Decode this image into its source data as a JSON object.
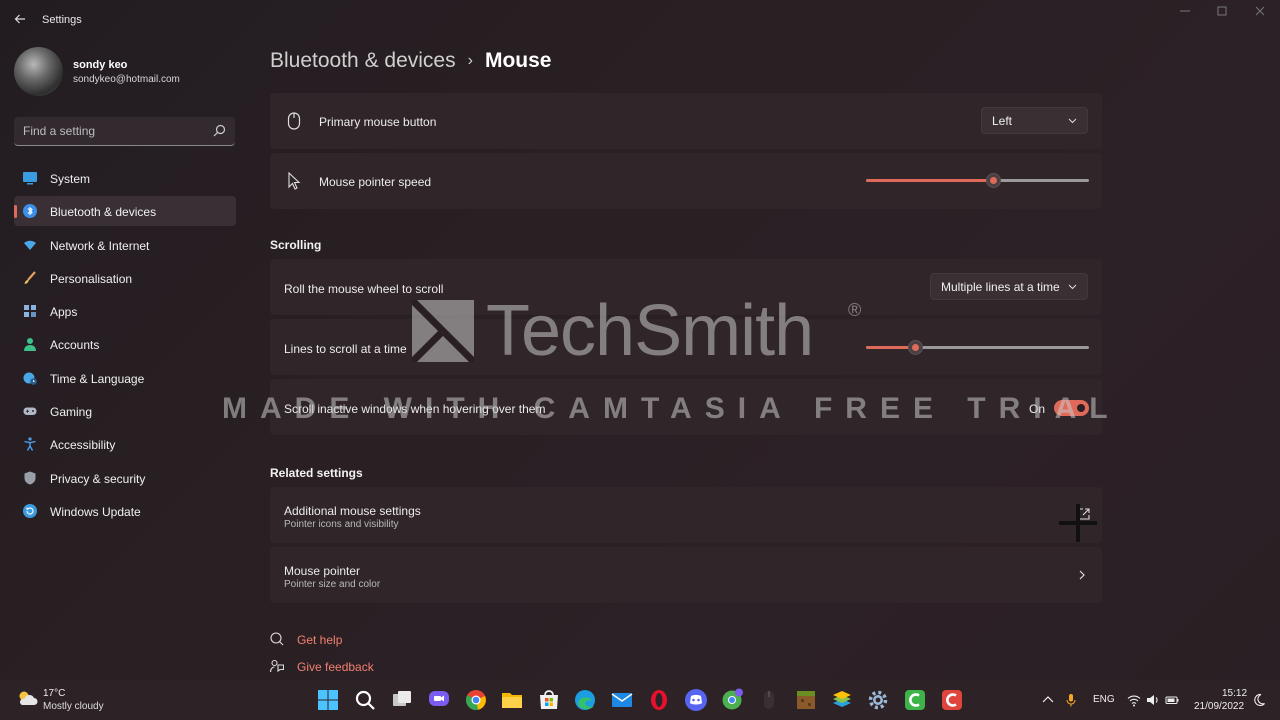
{
  "window": {
    "title": "Settings",
    "back_icon": "arrow-left-icon",
    "controls": [
      "minimize",
      "maximize",
      "close"
    ]
  },
  "profile": {
    "name": "sondy keo",
    "email": "sondykeo@hotmail.com"
  },
  "search": {
    "placeholder": "Find a setting",
    "icon": "search-icon"
  },
  "sidebar": {
    "items": [
      {
        "label": "System",
        "icon": "monitor-icon",
        "color": "#3b9be0"
      },
      {
        "label": "Bluetooth & devices",
        "icon": "bluetooth-icon",
        "color": "#3b8fe8",
        "active": true
      },
      {
        "label": "Network & Internet",
        "icon": "wifi-icon",
        "color": "#4aa8e8"
      },
      {
        "label": "Personalisation",
        "icon": "brush-icon",
        "color": "#e8a060"
      },
      {
        "label": "Apps",
        "icon": "apps-icon",
        "color": "#8ab4e0"
      },
      {
        "label": "Accounts",
        "icon": "person-icon",
        "color": "#3cc08a"
      },
      {
        "label": "Time & Language",
        "icon": "globe-clock-icon",
        "color": "#4aa8e8"
      },
      {
        "label": "Gaming",
        "icon": "gamepad-icon",
        "color": "#b0b8c8"
      },
      {
        "label": "Accessibility",
        "icon": "accessibility-icon",
        "color": "#4aa0f0"
      },
      {
        "label": "Privacy & security",
        "icon": "shield-icon",
        "color": "#9aa0a8"
      },
      {
        "label": "Windows Update",
        "icon": "update-icon",
        "color": "#3b9be0"
      }
    ]
  },
  "breadcrumb": {
    "parent": "Bluetooth & devices",
    "separator": "›",
    "current": "Mouse"
  },
  "settings": {
    "primary_button": {
      "label": "Primary mouse button",
      "value": "Left",
      "icon": "mouse-icon"
    },
    "pointer_speed": {
      "label": "Mouse pointer speed",
      "value_fraction": 0.57,
      "icon": "cursor-icon"
    }
  },
  "scrolling": {
    "title": "Scrolling",
    "wheel": {
      "label": "Roll the mouse wheel to scroll",
      "value": "Multiple lines at a time"
    },
    "lines": {
      "label": "Lines to scroll at a time",
      "value_fraction": 0.22
    },
    "inactive": {
      "label": "Scroll inactive windows when hovering over them",
      "state": "On"
    }
  },
  "related": {
    "title": "Related settings",
    "items": [
      {
        "label": "Additional mouse settings",
        "sub": "Pointer icons and visibility",
        "icon": "external-link-icon"
      },
      {
        "label": "Mouse pointer",
        "sub": "Pointer size and color",
        "icon": "chevron-right-icon"
      }
    ]
  },
  "links": {
    "help": "Get help",
    "feedback": "Give feedback"
  },
  "watermark": {
    "brand": "TechSmith",
    "reg": "®",
    "line": "MADE WITH CAMTASIA FREE TRIAL"
  },
  "taskbar": {
    "weather": {
      "temp": "17°C",
      "desc": "Mostly cloudy"
    },
    "apps": [
      "windows-start-icon",
      "search-icon",
      "task-view-icon",
      "chat-icon",
      "chrome-icon",
      "file-explorer-icon",
      "store-icon",
      "edge-icon",
      "mail-icon",
      "opera-icon",
      "discord-icon",
      "chrome-profile-icon",
      "mouse-app-icon",
      "minecraft-icon",
      "bluestacks-icon",
      "settings-icon",
      "camtasia-icon",
      "camtasia-recorder-icon"
    ],
    "tray": {
      "lang": "ENG",
      "time": "15:12",
      "date": "21/09/2022"
    }
  },
  "colors": {
    "accent": "#e06a5a",
    "background": "#2a2024",
    "card": "#302629"
  }
}
